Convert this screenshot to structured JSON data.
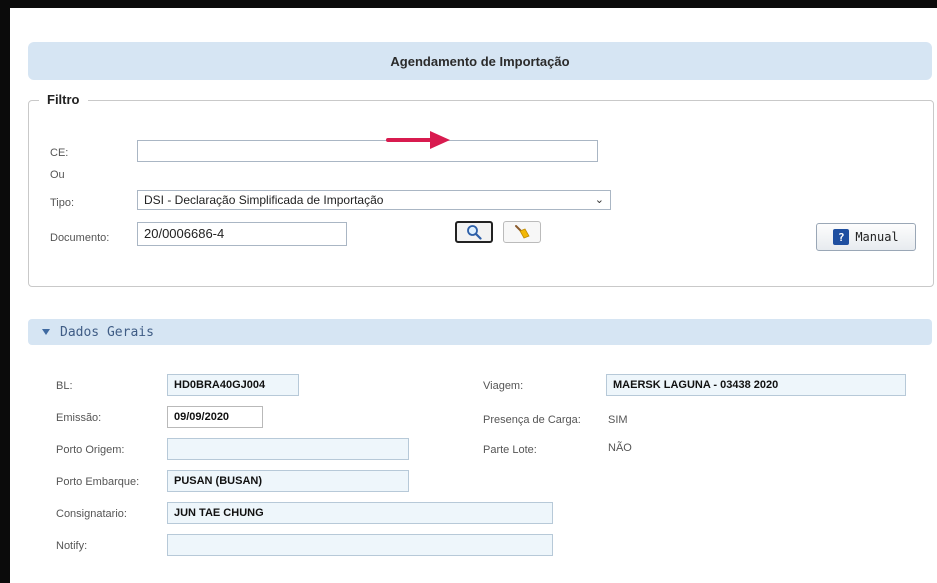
{
  "header": {
    "title": "Agendamento de Importação"
  },
  "filtro": {
    "legend": "Filtro",
    "ce_label": "CE:",
    "ce_value": "",
    "ou_label": "Ou",
    "tipo_label": "Tipo:",
    "tipo_selected": "DSI - Declaração Simplificada de Importação",
    "documento_label": "Documento:",
    "documento_value": "20/0006686-4",
    "manual_label": "Manual",
    "search_icon": "magnifier-icon",
    "clear_icon": "broom-icon",
    "help_icon": "help-book-icon",
    "arrow_color": "#d81b4f"
  },
  "dados_gerais": {
    "title": "Dados Gerais",
    "bl_label": "BL:",
    "bl_value": "HD0BRA40GJ004",
    "emissao_label": "Emissão:",
    "emissao_value": "09/09/2020",
    "porto_origem_label": "Porto Origem:",
    "porto_origem_value": "",
    "porto_embarque_label": "Porto Embarque:",
    "porto_embarque_value": "PUSAN (BUSAN)",
    "consignatario_label": "Consignatario:",
    "consignatario_value": "JUN TAE CHUNG",
    "notify_label": "Notify:",
    "notify_value": "",
    "viagem_label": "Viagem:",
    "viagem_value": "MAERSK LAGUNA - 03438  2020",
    "presenca_label": "Presença de Carga:",
    "presenca_value": "SIM",
    "parte_lote_label": "Parte Lote:",
    "parte_lote_value": "NÃO"
  }
}
